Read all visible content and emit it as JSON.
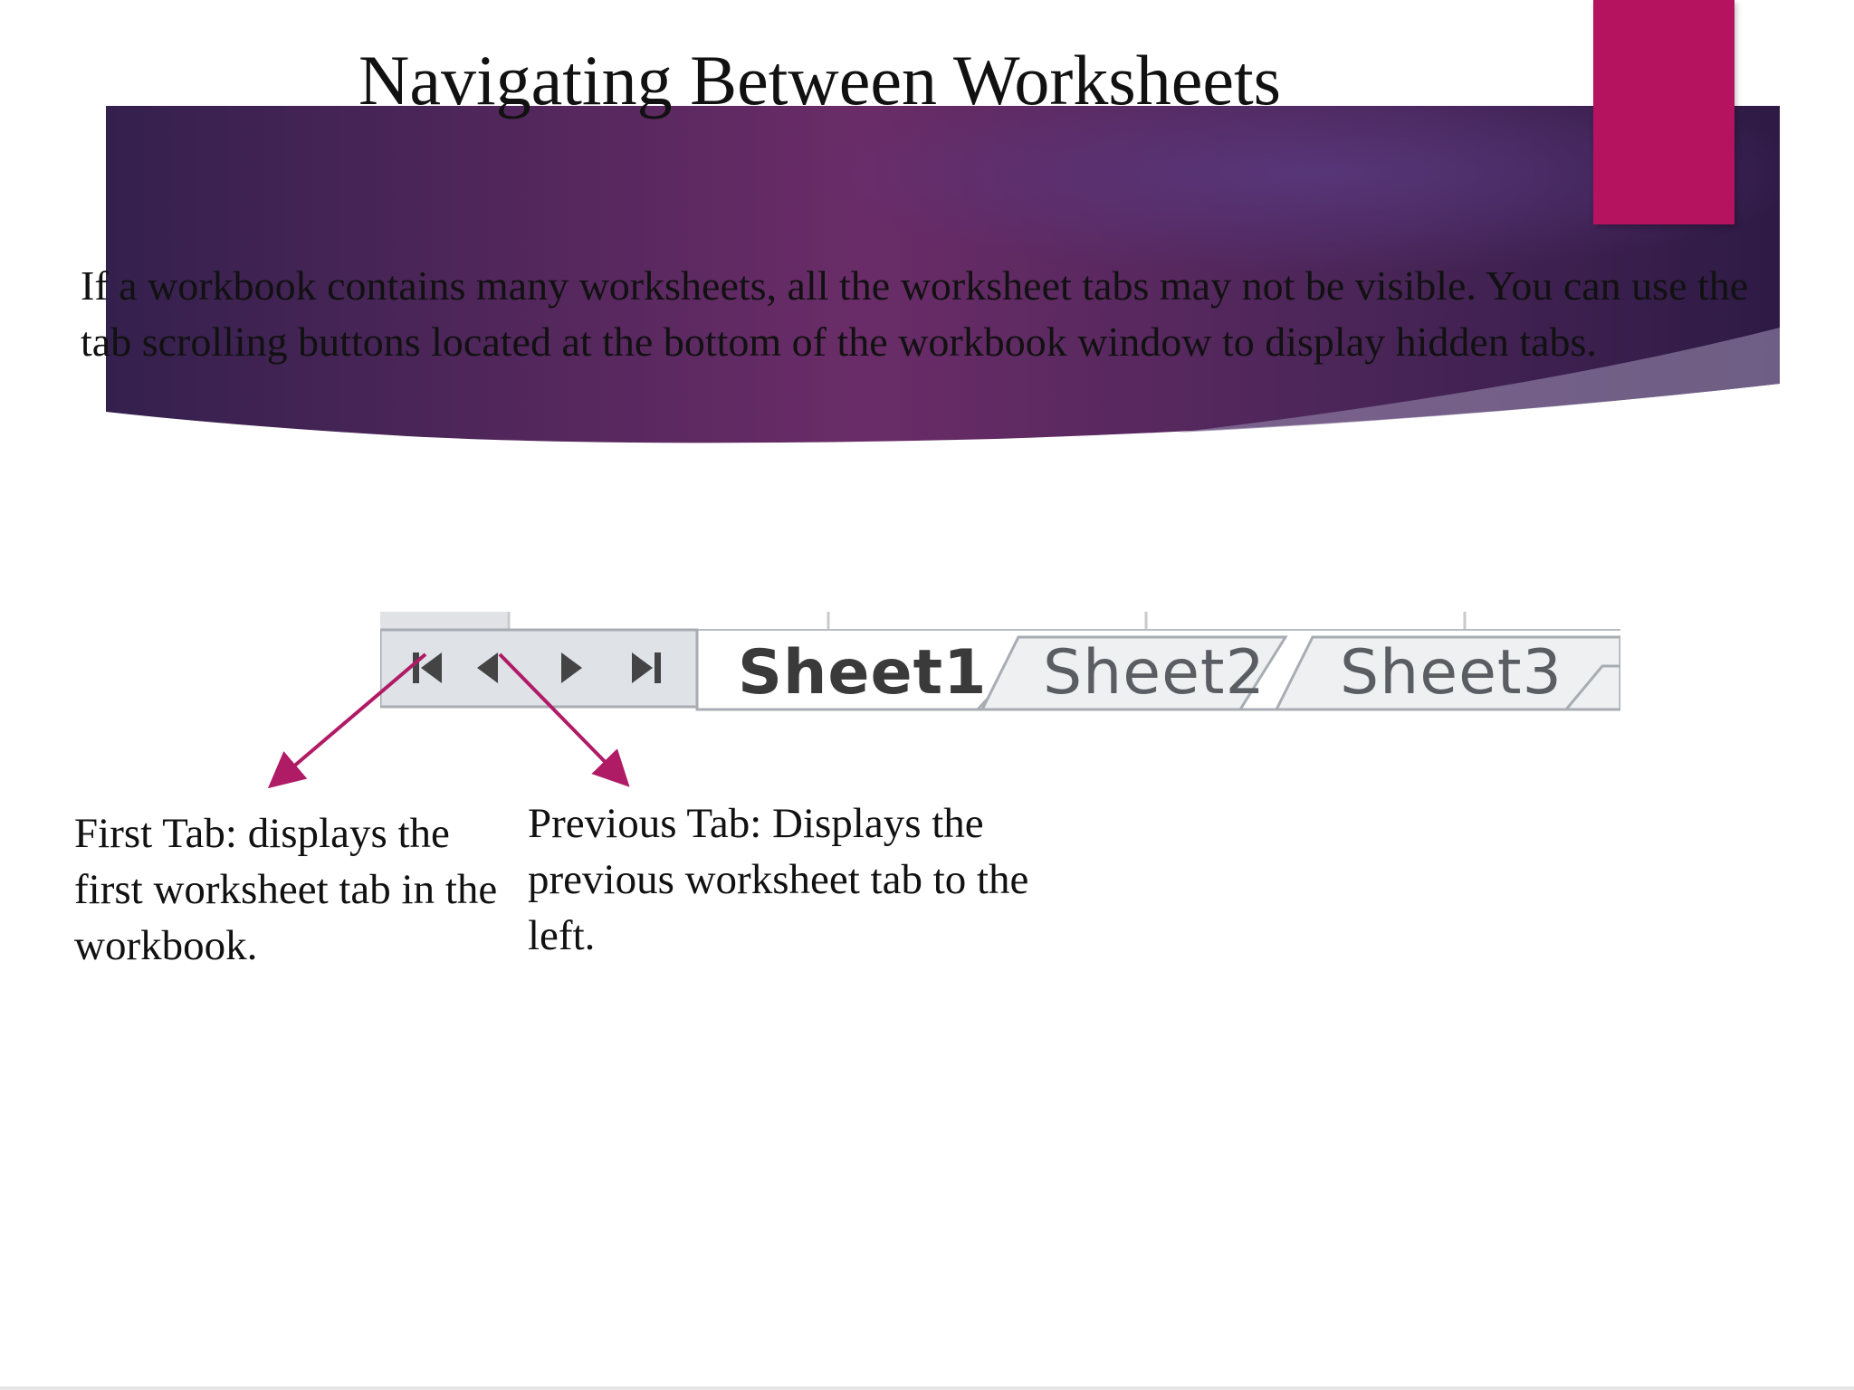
{
  "slide": {
    "title": "Navigating Between Worksheets",
    "body": "If a workbook contains many worksheets, all the worksheet tabs may not be visible. You can use the tab scrolling buttons located at the bottom of the workbook window to display hidden tabs.",
    "colors": {
      "banner_dark": "#2e1a45",
      "banner_mid": "#6a2c68",
      "accent": "#b5135f",
      "arrow": "#b01b66"
    }
  },
  "tabbar": {
    "buttons": [
      {
        "icon": "first-tab-icon"
      },
      {
        "icon": "previous-tab-icon"
      },
      {
        "icon": "next-tab-icon"
      },
      {
        "icon": "last-tab-icon"
      }
    ],
    "tabs": [
      {
        "label": "Sheet1",
        "active": true
      },
      {
        "label": "Sheet2",
        "active": false
      },
      {
        "label": "Sheet3",
        "active": false
      }
    ]
  },
  "annotations": {
    "first_tab": "First Tab: displays the first worksheet tab in the workbook.",
    "previous_tab": "Previous Tab: Displays the previous worksheet tab to the left."
  }
}
